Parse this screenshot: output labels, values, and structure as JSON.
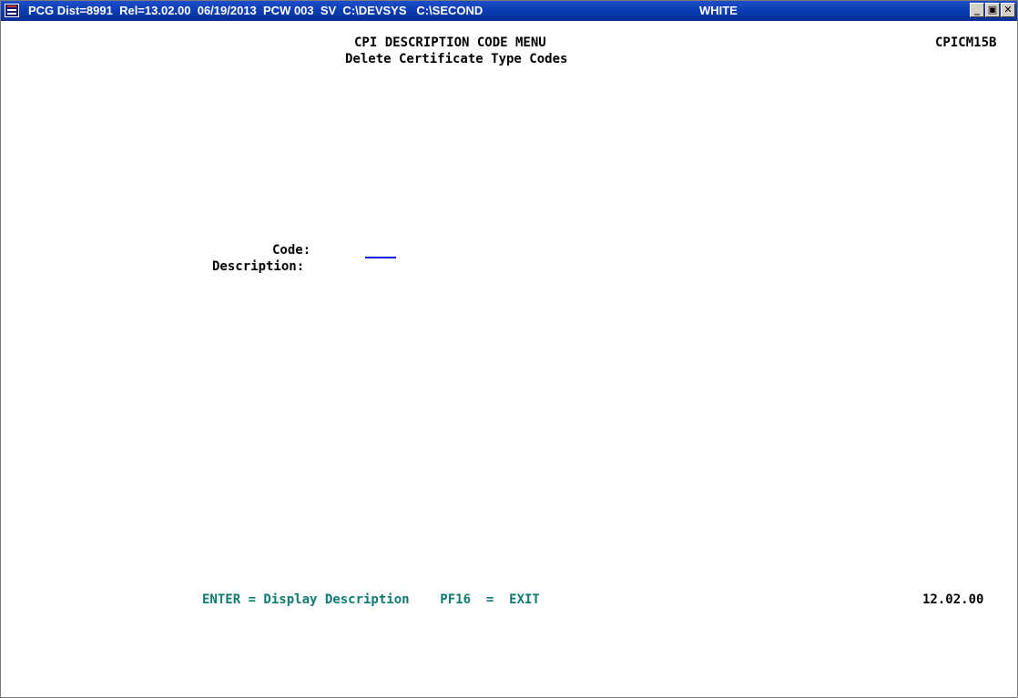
{
  "window": {
    "title": "PCG Dist=8991  Rel=13.02.00  06/19/2013  PCW 003  SV  C:\\DEVSYS   C:\\SECOND",
    "color_label": "WHITE",
    "minimize": "_",
    "restore": "▣",
    "close": "✕"
  },
  "screen": {
    "menu_title": "CPI DESCRIPTION CODE MENU",
    "subtitle": "Delete Certificate Type Codes",
    "screen_id": "CPICM15B"
  },
  "form": {
    "code_label": "Code:",
    "code_value": "",
    "description_label": "Description:"
  },
  "footer": {
    "keys": "ENTER = Display Description    PF16  =  EXIT",
    "version": "12.02.00"
  },
  "colors": {
    "titlebar": "#0a3bb4",
    "footer_text": "#0f7a73",
    "field_underline": "#1010e0"
  }
}
